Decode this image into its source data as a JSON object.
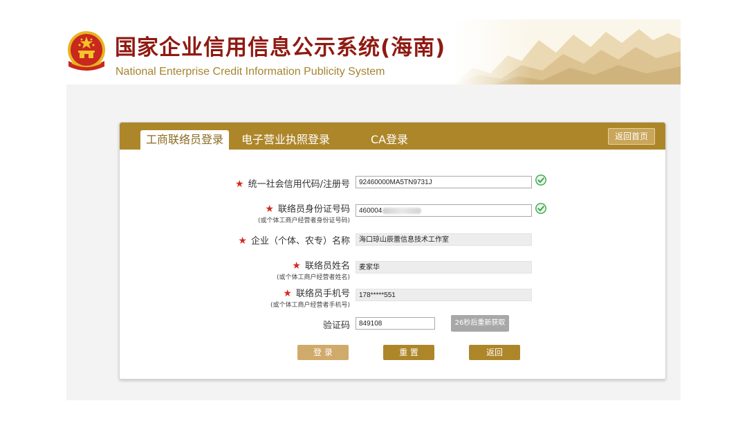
{
  "header": {
    "title": "国家企业信用信息公示系统(海南)",
    "subtitle": "National Enterprise Credit Information Publicity System",
    "emblem_icon": "national-emblem-icon"
  },
  "tabs": [
    {
      "label": "工商联络员登录",
      "active": true
    },
    {
      "label": "电子营业执照登录",
      "active": false
    },
    {
      "label": "CA登录",
      "active": false
    }
  ],
  "home_button": "返回首页",
  "form": {
    "credit_code": {
      "label": "统一社会信用代码/注册号",
      "value": "92460000MA5TN9731J",
      "verified": true
    },
    "id_number": {
      "label": "联络员身份证号码",
      "sublabel": "(或个体工商户经营者身份证号码)",
      "value": "460004",
      "verified": true
    },
    "company_name": {
      "label": "企业（个体、农专）名称",
      "value": "海口琼山辰蕾信息技术工作室"
    },
    "contact_name": {
      "label": "联络员姓名",
      "sublabel": "(或个体工商户经营者姓名)",
      "value": "麦家华"
    },
    "phone": {
      "label": "联络员手机号",
      "sublabel": "(或个体工商户经营者手机号)",
      "value": "178*****551"
    },
    "captcha": {
      "label": "验证码",
      "value": "849108",
      "resend_label": "26秒后重新获取"
    }
  },
  "buttons": {
    "login": "登 录",
    "reset": "重 置",
    "back": "返回"
  },
  "colors": {
    "title_red": "#8f1a12",
    "gold": "#ad8629",
    "star_red": "#d42a1f",
    "check_green": "#3aa64a"
  }
}
